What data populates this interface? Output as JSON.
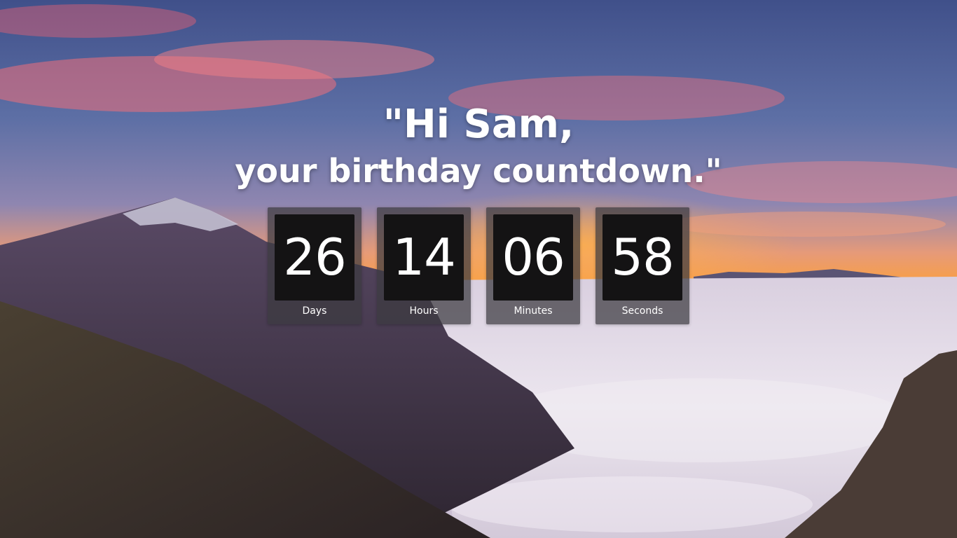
{
  "greeting": {
    "line1": "\"Hi Sam,",
    "line2": "your birthday countdown.\""
  },
  "countdown": [
    {
      "value": "26",
      "label": "Days"
    },
    {
      "value": "14",
      "label": "Hours"
    },
    {
      "value": "06",
      "label": "Minutes"
    },
    {
      "value": "58",
      "label": "Seconds"
    }
  ]
}
